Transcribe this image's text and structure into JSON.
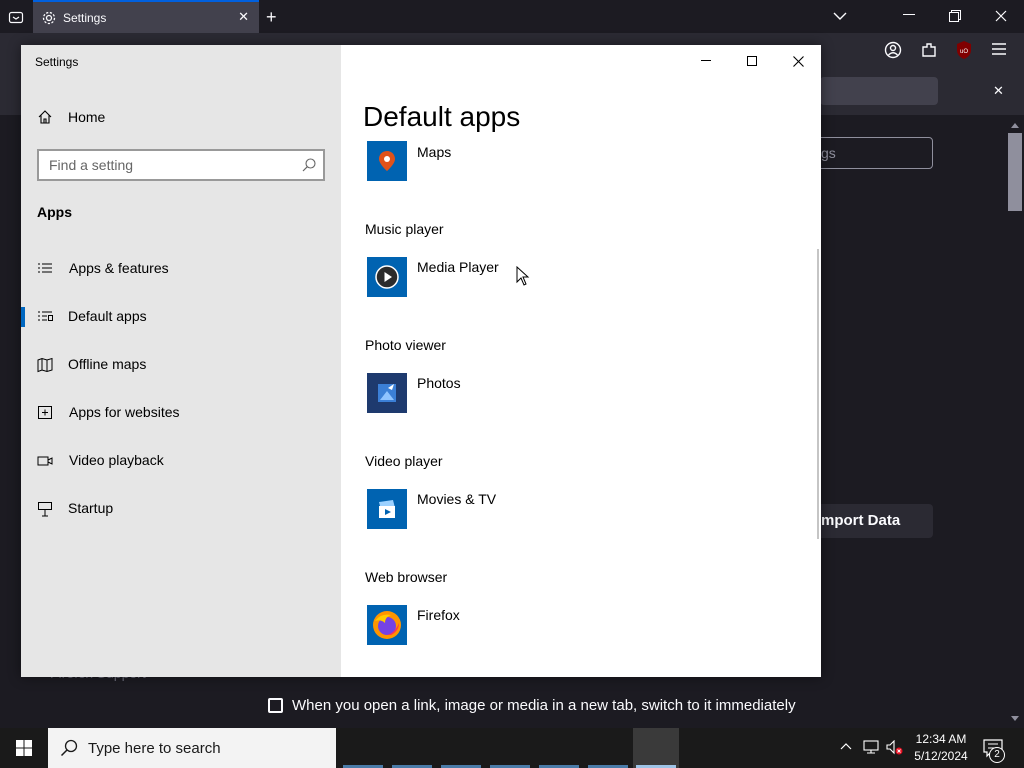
{
  "browser": {
    "tab_title": "Settings",
    "notice_close": "✕",
    "content": {
      "search_ghost": "gs",
      "import_button": "mport Data",
      "support_link": "Firefox Support",
      "link_setting_label": "When you open a link, image or media in a new tab, switch to it immediately"
    }
  },
  "settings": {
    "window_title": "Settings",
    "nav": {
      "home_label": "Home",
      "search_placeholder": "Find a setting",
      "section_title": "Apps",
      "items": [
        {
          "label": "Apps & features",
          "icon": "list-icon"
        },
        {
          "label": "Default apps",
          "icon": "default-apps-icon",
          "selected": true
        },
        {
          "label": "Offline maps",
          "icon": "map-icon"
        },
        {
          "label": "Apps for websites",
          "icon": "app-website-icon"
        },
        {
          "label": "Video playback",
          "icon": "video-icon"
        },
        {
          "label": "Startup",
          "icon": "startup-icon"
        }
      ]
    },
    "main": {
      "page_title": "Default apps",
      "entries": [
        {
          "category": "",
          "app": "Maps",
          "icon": "maps-app-icon",
          "color": "#0063b1"
        },
        {
          "category": "Music player",
          "app": "Media Player",
          "icon": "media-player-icon",
          "color": "#0063b1"
        },
        {
          "category": "Photo viewer",
          "app": "Photos",
          "icon": "photos-app-icon",
          "color": "#1e3a6e"
        },
        {
          "category": "Video player",
          "app": "Movies & TV",
          "icon": "movies-tv-icon",
          "color": "#0063b1"
        },
        {
          "category": "Web browser",
          "app": "Firefox",
          "icon": "firefox-icon",
          "color": "#0063b1"
        }
      ]
    }
  },
  "taskbar": {
    "search_placeholder": "Type here to search",
    "clock_time": "12:34 AM",
    "clock_date": "5/12/2024",
    "notification_count": "2"
  },
  "colors": {
    "accent": "#0067c0",
    "app_tile_blue": "#0063b1",
    "firefox_bg": "#1c1b22"
  }
}
